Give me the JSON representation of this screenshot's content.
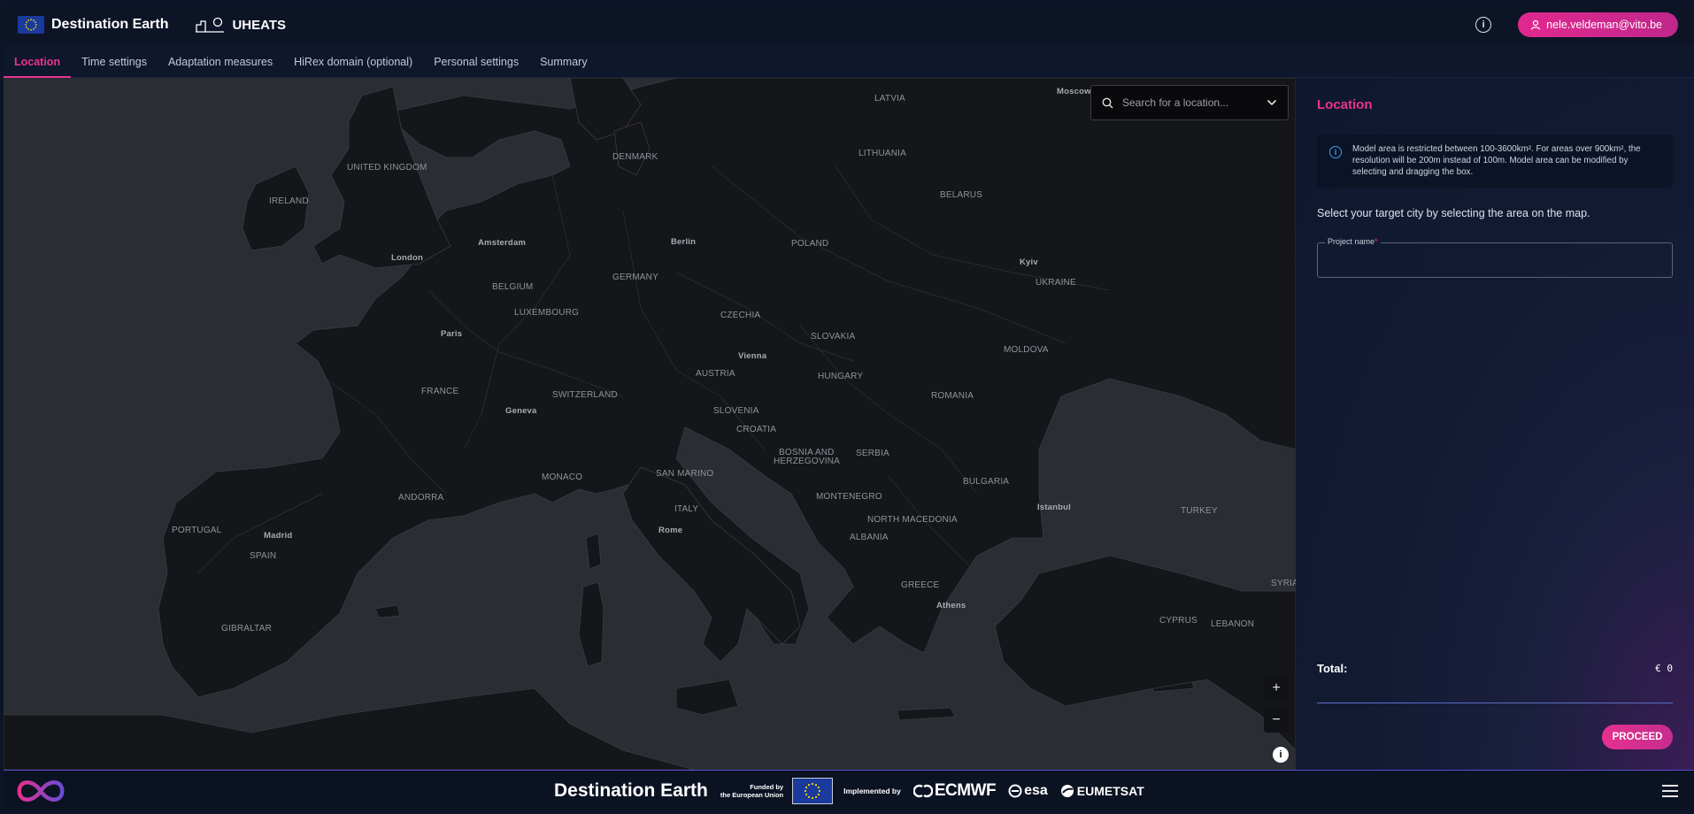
{
  "header": {
    "brand": "Destination Earth",
    "app_name": "UHEATS",
    "user": "nele.veldeman@vito.be"
  },
  "tabs": [
    {
      "label": "Location",
      "active": true
    },
    {
      "label": "Time settings",
      "active": false
    },
    {
      "label": "Adaptation measures",
      "active": false
    },
    {
      "label": "HiRex domain (optional)",
      "active": false
    },
    {
      "label": "Personal settings",
      "active": false
    },
    {
      "label": "Summary",
      "active": false
    }
  ],
  "map": {
    "search_placeholder": "Search for a location...",
    "zoom_in": "+",
    "zoom_out": "−",
    "attribution": "i",
    "labels": {
      "latvia": "LATVIA",
      "moscow": "Moscow",
      "denmark": "DENMARK",
      "lithuania": "LITHUANIA",
      "uk": "UNITED KINGDOM",
      "belarus": "BELARUS",
      "ireland": "IRELAND",
      "amsterdam": "Amsterdam",
      "berlin": "Berlin",
      "poland": "POLAND",
      "london": "London",
      "kyiv": "Kyiv",
      "germany": "GERMANY",
      "ukraine": "UKRAINE",
      "belgium": "BELGIUM",
      "luxembourg": "LUXEMBOURG",
      "czechia": "CZECHIA",
      "paris": "Paris",
      "slovakia": "SLOVAKIA",
      "moldova": "MOLDOVA",
      "vienna": "Vienna",
      "austria": "AUSTRIA",
      "hungary": "HUNGARY",
      "france": "FRANCE",
      "switzerland": "SWITZERLAND",
      "romania": "ROMANIA",
      "geneva": "Geneva",
      "slovenia": "SLOVENIA",
      "croatia": "CROATIA",
      "bosnia1": "BOSNIA AND",
      "bosnia2": "HERZEGOVINA",
      "serbia": "SERBIA",
      "monaco": "MONACO",
      "san_marino": "SAN MARINO",
      "bulgaria": "BULGARIA",
      "andorra": "ANDORRA",
      "montenegro": "MONTENEGRO",
      "istanbul": "Istanbul",
      "italy": "ITALY",
      "turkey": "TURKEY",
      "north_macedonia": "NORTH MACEDONIA",
      "portugal": "PORTUGAL",
      "madrid": "Madrid",
      "rome": "Rome",
      "albania": "ALBANIA",
      "spain": "SPAIN",
      "syria": "SYRIA",
      "greece": "GREECE",
      "athens": "Athens",
      "gibraltar": "GIBRALTAR",
      "cyprus": "CYPRUS",
      "lebanon": "LEBANON"
    }
  },
  "panel": {
    "title": "Location",
    "notice": "Model area is restricted between 100-3600km². For areas over 900km², the resolution will be 200m instead of 100m. Model area can be modified by selecting and dragging the box.",
    "instruction": "Select your target city by selecting the area on the map.",
    "project_name_label": "Project name",
    "project_name_required": "*",
    "project_name_value": "",
    "total_label": "Total:",
    "total_value": "€ 0",
    "proceed": "PROCEED"
  },
  "footer": {
    "title": "Destination Earth",
    "funded_line1": "Funded by",
    "funded_line2": "the European Union",
    "implemented": "Implemented by",
    "partners": [
      "ECMWF",
      "esa",
      "EUMETSAT"
    ]
  },
  "colors": {
    "accent": "#e8338f",
    "background": "#0d1528",
    "map_water": "#2a2d33",
    "map_land": "#151619"
  }
}
